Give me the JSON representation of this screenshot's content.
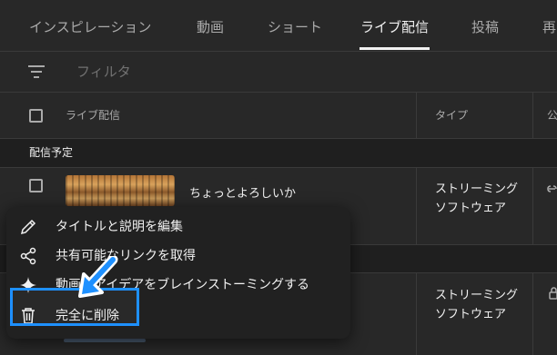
{
  "tabs": [
    "インスピレーション",
    "動画",
    "ショート",
    "ライブ配信",
    "投稿",
    "再"
  ],
  "active_tab": "ライブ配信",
  "filter": {
    "placeholder": "フィルタ"
  },
  "table": {
    "header_title": "ライブ配信",
    "header_type": "タイプ",
    "header_visibility": "公"
  },
  "section": {
    "label": "配信予定"
  },
  "rows": [
    {
      "title": "ちょっとよろしいか",
      "type_line1": "ストリーミング",
      "type_line2": "ソフトウェア"
    },
    {
      "title": "",
      "type_line1": "ストリーミング",
      "type_line2": "ソフトウェア"
    }
  ],
  "menu": {
    "items": [
      {
        "label": "タイトルと説明を編集",
        "icon": "pencil-icon"
      },
      {
        "label": "共有可能なリンクを取得",
        "icon": "share-icon"
      },
      {
        "label": "動画のアイデアをブレインストーミングする",
        "icon": "sparkle-icon"
      },
      {
        "label": "完全に削除",
        "icon": "trash-icon"
      }
    ]
  },
  "colors": {
    "background": "#282828",
    "highlight": "#1e90ff",
    "text": "#f1f1f1",
    "muted": "#aaaaaa"
  }
}
